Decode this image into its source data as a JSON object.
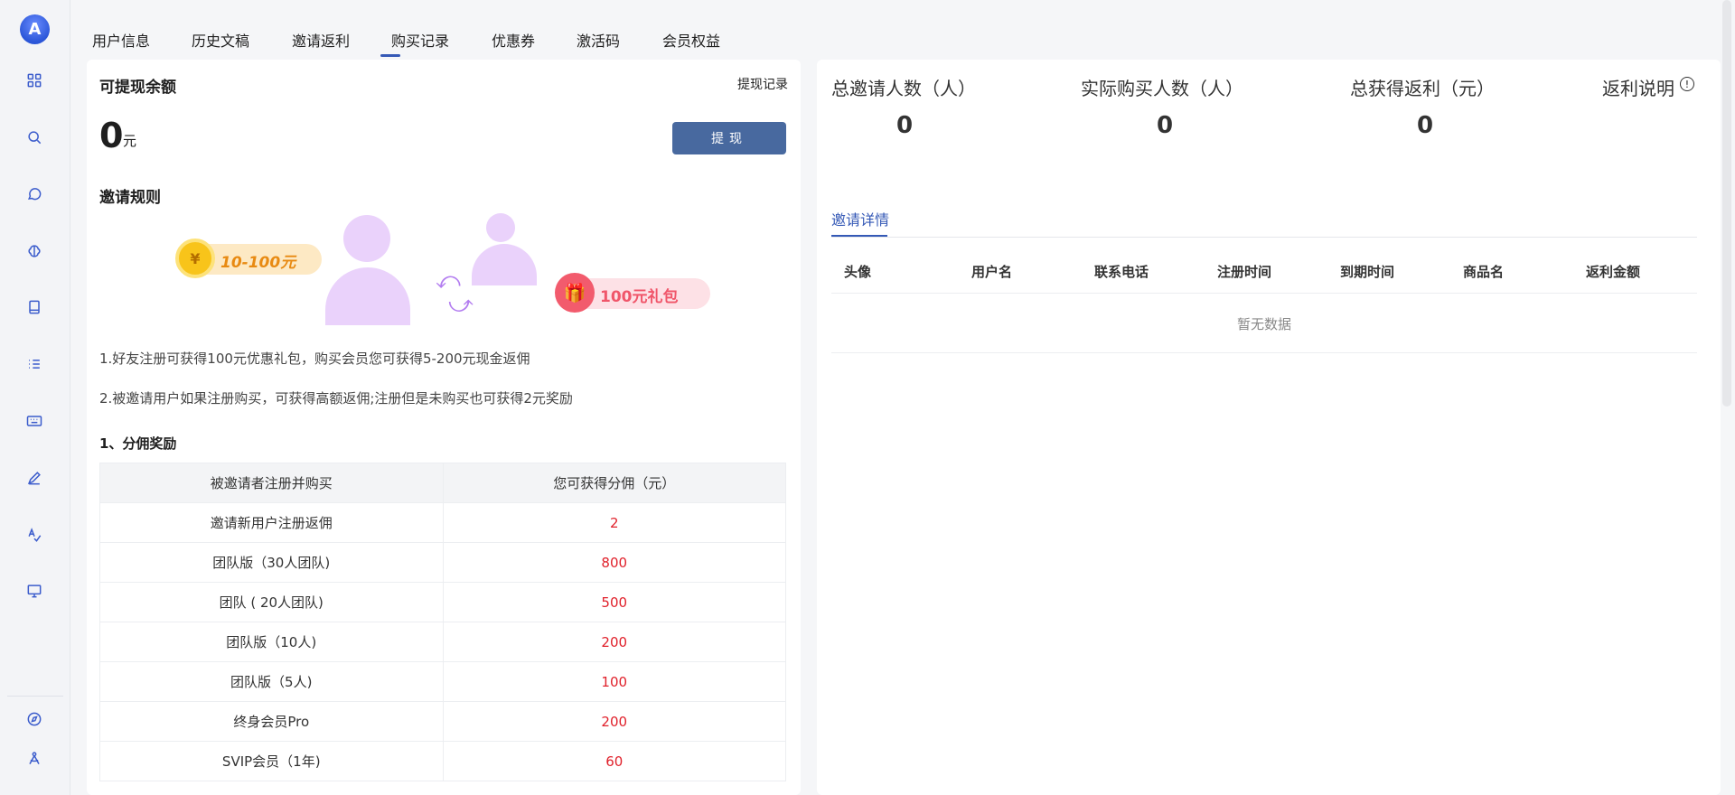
{
  "sidebar": {
    "logo_text": "A",
    "icons": [
      "grid-icon",
      "search-icon",
      "chat-icon",
      "brain-icon",
      "book-icon",
      "list-icon",
      "keyboard-icon",
      "pen-icon",
      "spellcheck-icon",
      "presentation-icon",
      "compass-icon",
      "draw-icon"
    ]
  },
  "tabs": [
    {
      "label": "用户信息"
    },
    {
      "label": "历史文稿"
    },
    {
      "label": "邀请返利"
    },
    {
      "label": "购买记录"
    },
    {
      "label": "优惠券"
    },
    {
      "label": "激活码"
    },
    {
      "label": "会员权益"
    }
  ],
  "balance": {
    "title": "可提现余额",
    "record_link": "提现记录",
    "amount": "0",
    "unit": "元",
    "withdraw_label": "提现"
  },
  "rules": {
    "title": "邀请规则",
    "badge_cash": "10-100元",
    "badge_gift": "100元礼包",
    "line1": "1.好友注册可获得100元优惠礼包，购买会员您可获得5-200元现金返佣",
    "line2": "2.被邀请用户如果注册购买，可获得高额返佣;注册但是未购买也可获得2元奖励"
  },
  "commission": {
    "section_title": "1、分佣奖励",
    "headers": [
      "被邀请者注册并购买",
      "您可获得分佣（元）"
    ],
    "rows": [
      {
        "item": "邀请新用户注册返佣",
        "value": "2"
      },
      {
        "item": "团队版（30人团队)",
        "value": "800"
      },
      {
        "item": "团队 ( 20人团队)",
        "value": "500"
      },
      {
        "item": "团队版（10人)",
        "value": "200"
      },
      {
        "item": "团队版（5人)",
        "value": "100"
      },
      {
        "item": "终身会员Pro",
        "value": "200"
      },
      {
        "item": "SVIP会员（1年)",
        "value": "60"
      }
    ]
  },
  "stats": {
    "total_invited_label": "总邀请人数（人）",
    "total_invited": "0",
    "actual_buyers_label": "实际购买人数（人）",
    "actual_buyers": "0",
    "total_rebate_label": "总获得返利（元）",
    "total_rebate": "0",
    "rebate_info_label": "返利说明"
  },
  "details": {
    "tab_label": "邀请详情",
    "columns": [
      "头像",
      "用户名",
      "联系电话",
      "注册时间",
      "到期时间",
      "商品名",
      "返利金额"
    ],
    "empty_text": "暂无数据"
  },
  "colors": {
    "accent": "#3559b6",
    "button": "#48699f",
    "value_red": "#e0212b"
  }
}
